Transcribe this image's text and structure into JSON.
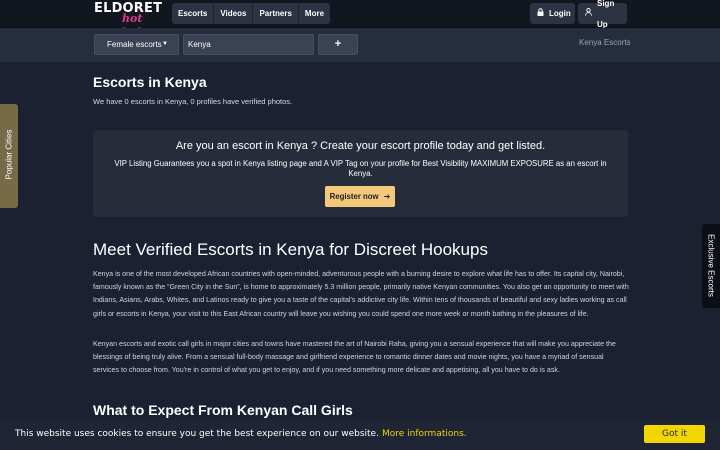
{
  "brand": {
    "logo_top": "ELDORET",
    "logo_bottom": "hot babes"
  },
  "nav": {
    "items": [
      "Escorts",
      "Videos",
      "Partners",
      "More"
    ]
  },
  "auth": {
    "login_label": "Login",
    "signup_label": "Sign Up"
  },
  "search": {
    "category_selected": "Female escorts",
    "location_value": "Kenya",
    "add_label": "+"
  },
  "breadcrumb": "Kenya Escorts",
  "main": {
    "title": "Escorts in Kenya",
    "subtitle": "We have 0 escorts in Kenya, 0 profiles have verified photos.",
    "promo": {
      "title": "Are you an escort in Kenya ? Create your escort profile today and get listed.",
      "text": "VIP Listing Guarantees you a spot in Kenya listing page and A VIP Tag on your profile for Best Visibility MAXIMUM EXPOSURE as an escort in Kenya.",
      "button_label": "Register now"
    },
    "heading": "Meet Verified Escorts in Kenya for Discreet Hookups",
    "paragraph1": "Kenya is one of the most developed African countries with open-minded, adventurous people with a burning desire to explore what life has to offer. Its capital city, Nairobi, famously known as the “Green City in the Sun”, is home to approximately 5.3 million people, primarily native Kenyan communities. You also get an opportunity to meet with Indians, Asians, Arabs, Whites, and Latinos ready to give you a taste of the capital's addictive city life. Within tens of thousands of beautiful and sexy ladies working as call girls or escorts in Kenya, your visit to this East African country will leave you wishing you could spend one more week or month bathing in the pleasures of life.",
    "paragraph2": "Kenyan escorts and exotic call girls in major cities and towns have mastered the art of Nairobi Raha, giving you a sensual experience that will make you appreciate the blessings of being truly alive. From a sensual full-body massage and girlfriend experience to romantic dinner dates and movie nights, you have a myriad of sensual services to choose from. You're in control of what you get to enjoy, and if you need something more delicate and appetising, all you have to do is ask.",
    "subheading": "What to Expect From Kenyan Call Girls"
  },
  "side_tabs": {
    "left": "Popular Cities",
    "right": "Exclusive Escorts"
  },
  "cookie": {
    "text": "This website uses cookies to ensure you get the best experience on our website.",
    "link": "More informations.",
    "button": "Got it"
  },
  "icons": {
    "login": "lock-icon",
    "signup": "user-icon",
    "register": "arrow-right-icon",
    "category": "caret-down-icon"
  },
  "colors": {
    "accent_button": "#f4c87a",
    "cookie_accent": "#f1d600",
    "left_tab": "#776a47"
  }
}
